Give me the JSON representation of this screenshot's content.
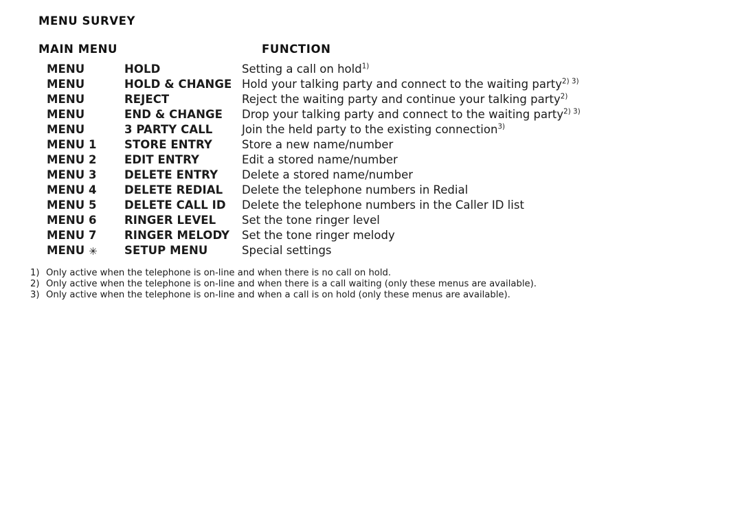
{
  "document": {
    "title": "MENU SURVEY",
    "background_color": "#ffffff",
    "text_color": "#1a1a1a"
  },
  "table": {
    "headers": {
      "main_menu": "MAIN MENU",
      "function": "FUNCTION"
    },
    "rows": [
      {
        "menu": "MENU",
        "item": "HOLD",
        "description": "Setting a call on hold",
        "footnote_refs": "1)"
      },
      {
        "menu": "MENU",
        "item": "HOLD & CHANGE",
        "description": "Hold your talking party and connect to the waiting party",
        "footnote_refs": "2) 3)"
      },
      {
        "menu": "MENU",
        "item": "REJECT",
        "description": "Reject the waiting party and continue your talking party",
        "footnote_refs": "2)"
      },
      {
        "menu": "MENU",
        "item": "END & CHANGE",
        "description": "Drop your talking party and connect to the waiting party",
        "footnote_refs": "2) 3)"
      },
      {
        "menu": "MENU",
        "item": "3 PARTY CALL",
        "description": "Join the held party to the existing connection",
        "footnote_refs": "3)"
      },
      {
        "menu": "MENU 1",
        "item": "STORE ENTRY",
        "description": "Store a new name/number",
        "footnote_refs": ""
      },
      {
        "menu": "MENU 2",
        "item": "EDIT ENTRY",
        "description": "Edit a stored name/number",
        "footnote_refs": ""
      },
      {
        "menu": "MENU 3",
        "item": "DELETE ENTRY",
        "description": "Delete a stored name/number",
        "footnote_refs": ""
      },
      {
        "menu": "MENU 4",
        "item": "DELETE REDIAL",
        "description": "Delete the telephone numbers in Redial",
        "footnote_refs": ""
      },
      {
        "menu": "MENU 5",
        "item": "DELETE CALL ID",
        "description": "Delete the telephone numbers in the Caller ID list",
        "footnote_refs": ""
      },
      {
        "menu": "MENU 6",
        "item": "RINGER LEVEL",
        "description": "Set the tone ringer level",
        "footnote_refs": ""
      },
      {
        "menu": "MENU 7",
        "item": "RINGER MELODY",
        "description": "Set the tone ringer melody",
        "footnote_refs": ""
      },
      {
        "menu": "MENU ✳",
        "menu_prefix": "MENU ",
        "menu_symbol": "✳",
        "menu_symbol_name": "asterisk-star-icon",
        "item": "SETUP MENU",
        "description": "Special settings",
        "footnote_refs": ""
      }
    ]
  },
  "footnotes": [
    {
      "marker": "1)",
      "text": "Only active when the telephone is on-line and when there is no call on hold."
    },
    {
      "marker": "2)",
      "text": "Only active when the telephone is on-line and when there is a call waiting (only these menus are available)."
    },
    {
      "marker": "3)",
      "text": "Only active when the telephone is on-line and when a call is on hold (only these menus are available)."
    }
  ]
}
